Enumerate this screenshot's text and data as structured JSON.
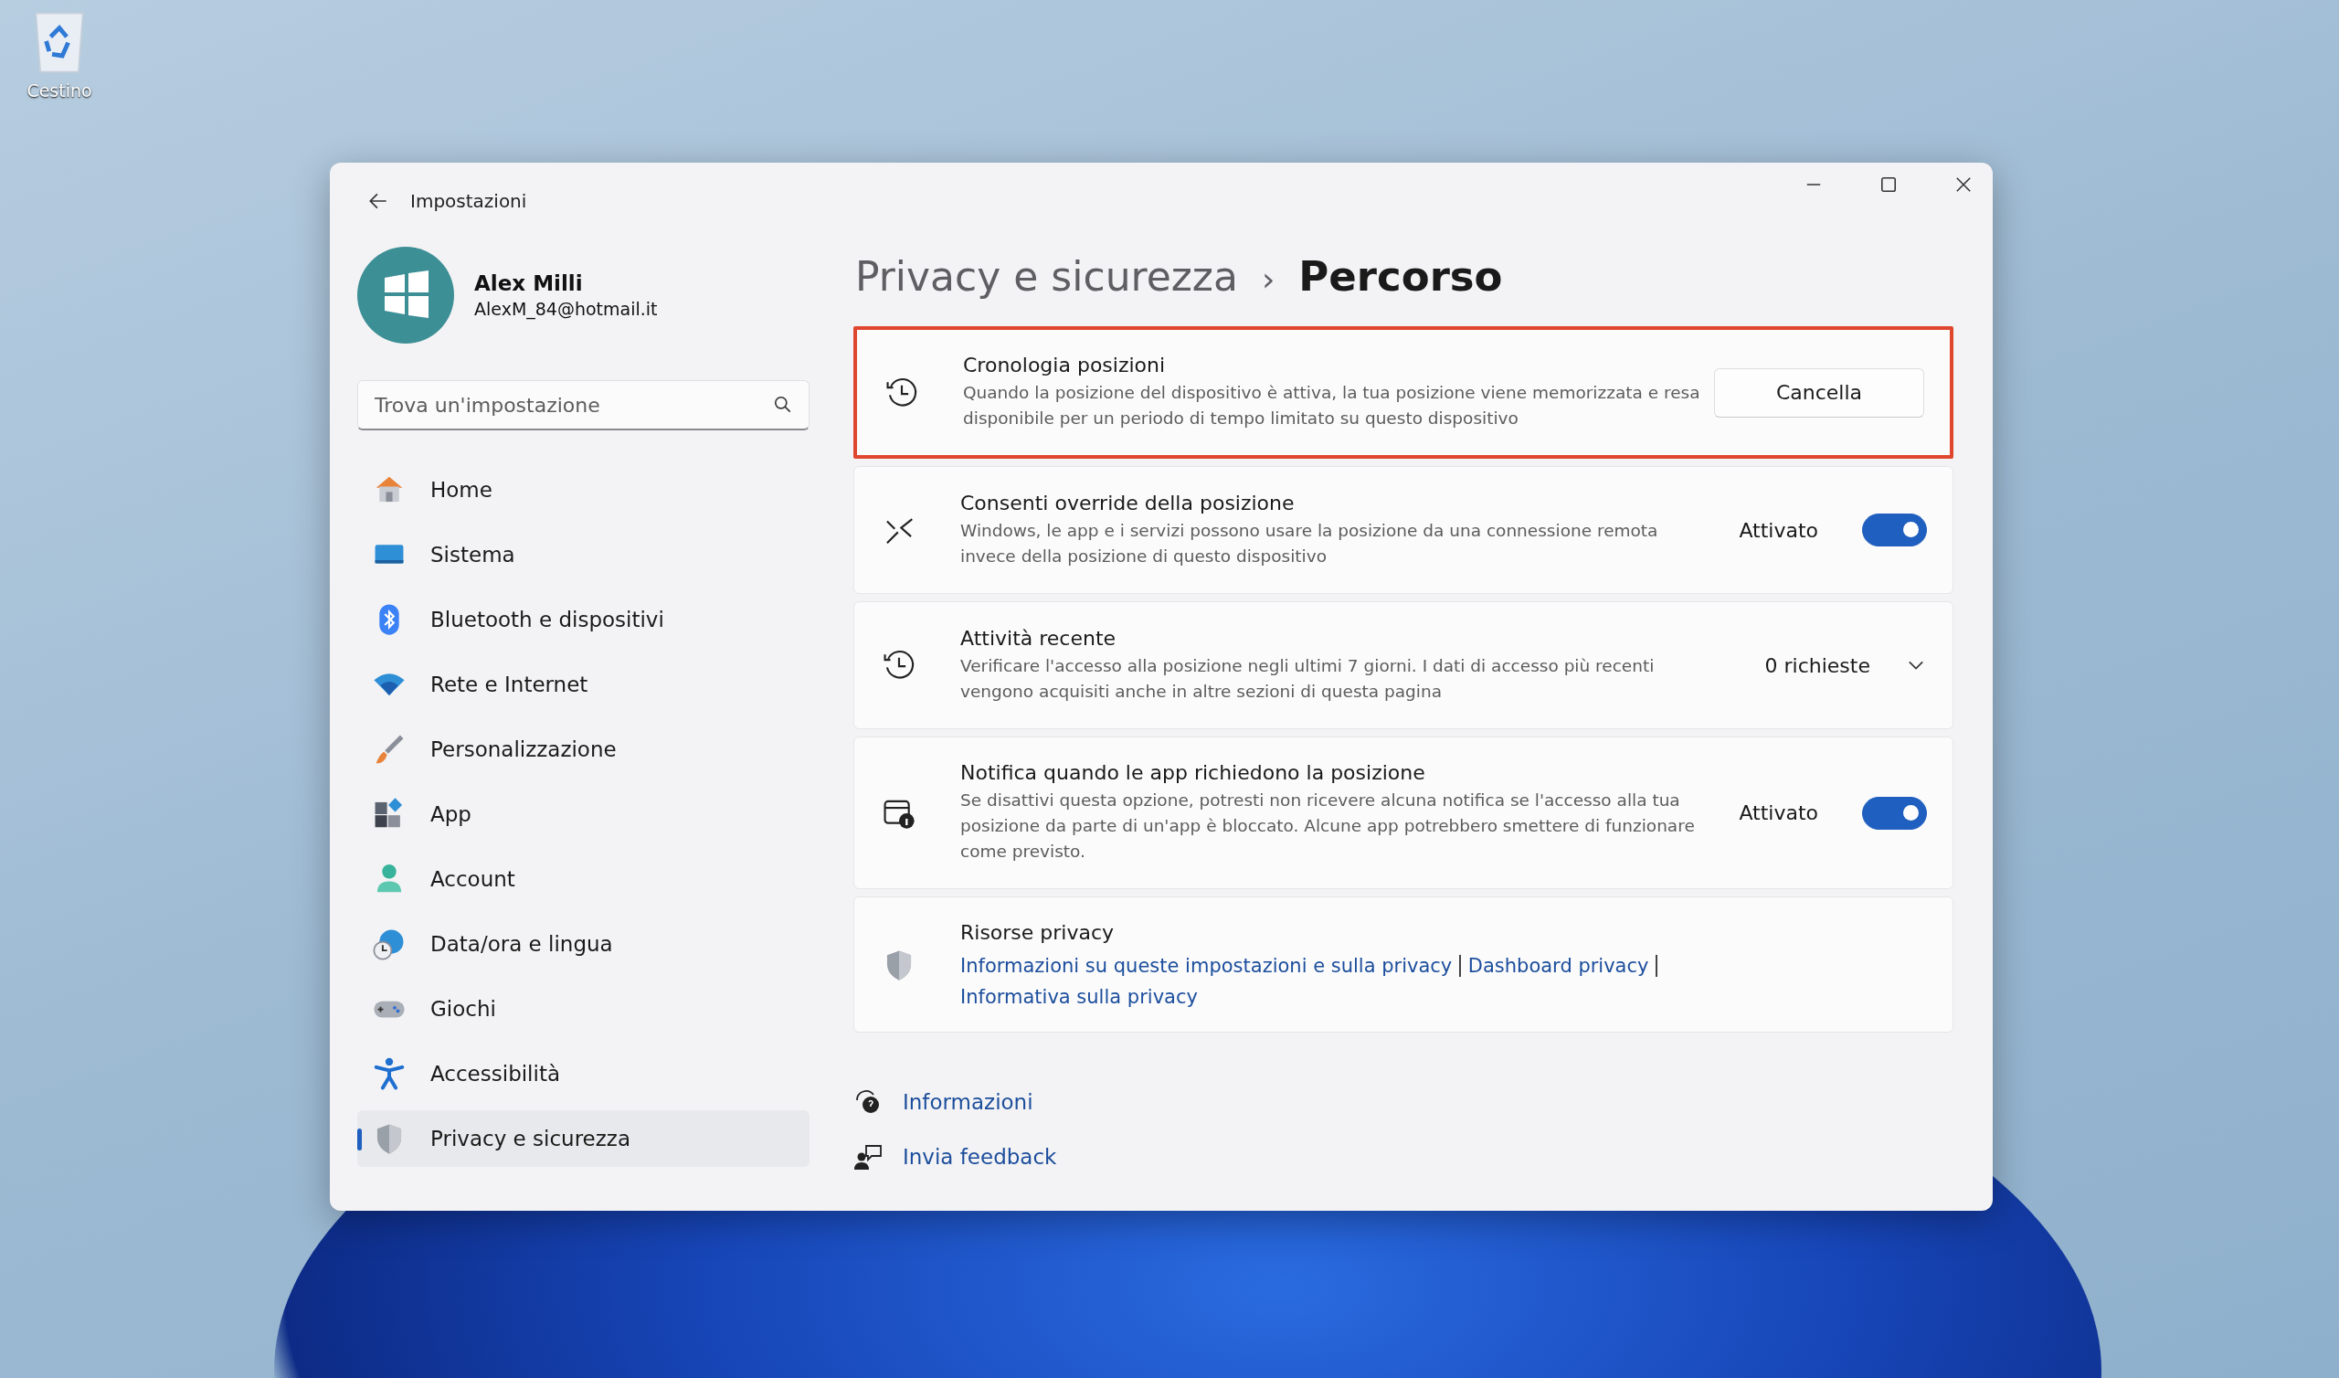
{
  "desktop_icons": [
    {
      "label": "Cestino"
    }
  ],
  "window": {
    "title": "Impostazioni"
  },
  "user": {
    "name": "Alex Milli",
    "email": "AlexM_84@hotmail.it"
  },
  "search": {
    "placeholder": "Trova un'impostazione"
  },
  "nav": [
    {
      "label": "Home",
      "selected": false
    },
    {
      "label": "Sistema",
      "selected": false
    },
    {
      "label": "Bluetooth e dispositivi",
      "selected": false
    },
    {
      "label": "Rete e Internet",
      "selected": false
    },
    {
      "label": "Personalizzazione",
      "selected": false
    },
    {
      "label": "App",
      "selected": false
    },
    {
      "label": "Account",
      "selected": false
    },
    {
      "label": "Data/ora e lingua",
      "selected": false
    },
    {
      "label": "Giochi",
      "selected": false
    },
    {
      "label": "Accessibilità",
      "selected": false
    },
    {
      "label": "Privacy e sicurezza",
      "selected": true
    }
  ],
  "breadcrumb": {
    "parent": "Privacy e sicurezza",
    "separator": "›",
    "current": "Percorso"
  },
  "settings": [
    {
      "kind": "button",
      "title": "Cronologia posizioni",
      "description": "Quando la posizione del dispositivo è attiva, la tua posizione viene memorizzata e resa disponibile per un periodo di tempo limitato su questo dispositivo",
      "button": "Cancella",
      "highlighted": true
    },
    {
      "kind": "toggle",
      "title": "Consenti override della posizione",
      "description": "Windows, le app e i servizi possono usare la posizione da una connessione remota invece della posizione di questo dispositivo",
      "state_label": "Attivato",
      "on": true,
      "highlighted": false
    },
    {
      "kind": "dropdown",
      "title": "Attività recente",
      "description": "Verificare l'accesso alla posizione negli ultimi 7 giorni. I dati di accesso più recenti vengono acquisiti anche in altre sezioni di questa pagina",
      "value": "0 richieste",
      "expanded": false,
      "highlighted": false
    },
    {
      "kind": "toggle",
      "title": "Notifica quando le app richiedono la posizione",
      "description": "Se disattivi questa opzione, potresti non ricevere alcuna notifica se l'accesso alla tua posizione da parte di un'app è bloccato. Alcune app potrebbero smettere di funzionare come previsto.",
      "state_label": "Attivato",
      "on": true,
      "highlighted": false
    },
    {
      "kind": "links",
      "title": "Risorse privacy",
      "links": [
        "Informazioni su queste impostazioni e sulla privacy",
        "Dashboard privacy",
        "Informativa sulla privacy"
      ],
      "highlighted": false
    }
  ],
  "footer_links": [
    "Informazioni",
    "Invia feedback"
  ]
}
